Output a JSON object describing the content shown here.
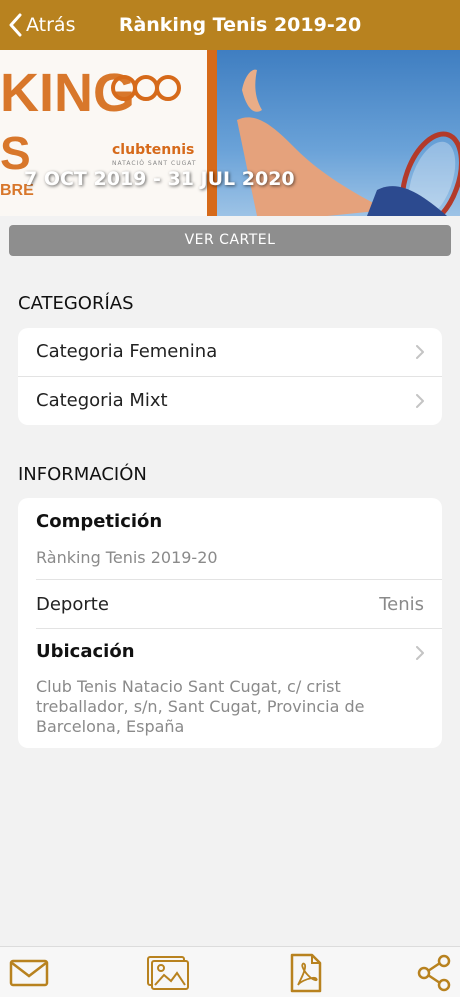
{
  "header": {
    "back_label": "Atrás",
    "title": "Rànking Tenis 2019-20"
  },
  "banner": {
    "big_line1": "KING",
    "big_line2": "S",
    "small_left": "BRE",
    "logo_text": "clubtennis",
    "logo_sub": "NATACIÓ SANT CUGAT",
    "dates": "7 OCT 2019 - 31 JUL 2020"
  },
  "ver_cartel_label": "VER CARTEL",
  "categorias": {
    "title": "CATEGORÍAS",
    "items": [
      {
        "label": "Categoria Femenina"
      },
      {
        "label": "Categoria Mixt"
      }
    ]
  },
  "informacion": {
    "title": "INFORMACIÓN",
    "competicion": {
      "label": "Competición",
      "value": "Rànking Tenis 2019-20"
    },
    "deporte": {
      "label": "Deporte",
      "value": "Tenis"
    },
    "ubicacion": {
      "label": "Ubicación",
      "line1": "Club Tenis Natacio Sant Cugat, c/ crist",
      "line2": "treballador, s/n, Sant Cugat, Provincia de",
      "line3": "Barcelona, España"
    }
  },
  "tabbar": {
    "icons": [
      "mail-icon",
      "gallery-icon",
      "pdf-icon",
      "share-icon"
    ]
  },
  "colors": {
    "accent": "#b8821f",
    "button_gray": "#8e8e8e",
    "banner_orange": "#d66a1a"
  }
}
